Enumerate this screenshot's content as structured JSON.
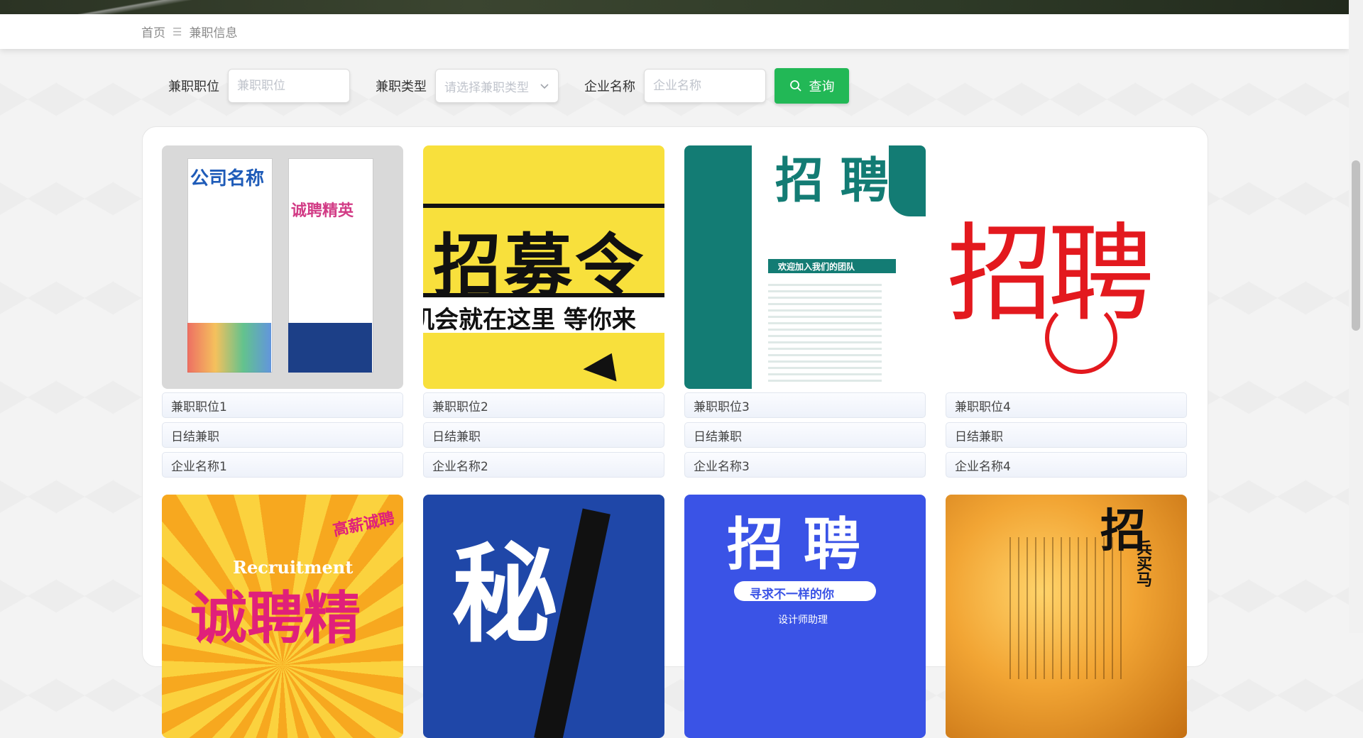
{
  "breadcrumb": {
    "home": "首页",
    "separator": "☰",
    "current": "兼职信息"
  },
  "search": {
    "position_label": "兼职职位",
    "position_placeholder": "兼职职位",
    "type_label": "兼职类型",
    "type_placeholder": "请选择兼职类型",
    "company_label": "企业名称",
    "company_placeholder": "企业名称",
    "button_label": "查询",
    "button_color": "#22b856"
  },
  "cards": [
    {
      "position": "兼职职位1",
      "type": "日结兼职",
      "company": "企业名称1",
      "poster": {
        "line1": "公司名称",
        "line2": "诚聘精英",
        "bg": "#dcdcdc"
      }
    },
    {
      "position": "兼职职位2",
      "type": "日结兼职",
      "company": "企业名称2",
      "poster": {
        "line1": "招募令",
        "line2": "机会就在这里 等你来",
        "bg": "#f8e03c"
      }
    },
    {
      "position": "兼职职位3",
      "type": "日结兼职",
      "company": "企业名称3",
      "poster": {
        "line1": "招 聘",
        "line2": "欢迎加入我们的团队",
        "bg": "#ffffff"
      }
    },
    {
      "position": "兼职职位4",
      "type": "日结兼职",
      "company": "企业名称4",
      "poster": {
        "line1": "招聘",
        "line2": "",
        "bg": "#ffffff"
      }
    }
  ],
  "second_row": [
    {
      "poster": {
        "line1": "诚聘精",
        "line2": "Recruitment",
        "line3": "高薪诚聘",
        "bg": "#f7a81f"
      }
    },
    {
      "poster": {
        "line1": "秘",
        "line2": "",
        "bg": "#1f47a8"
      }
    },
    {
      "poster": {
        "line1": "招 聘",
        "line2": "寻求不一样的你",
        "line3": "设计师助理",
        "bg": "#3a53e6"
      }
    },
    {
      "poster": {
        "line1": "招",
        "line2": "兵买马",
        "bg": "#f0a030"
      }
    }
  ]
}
